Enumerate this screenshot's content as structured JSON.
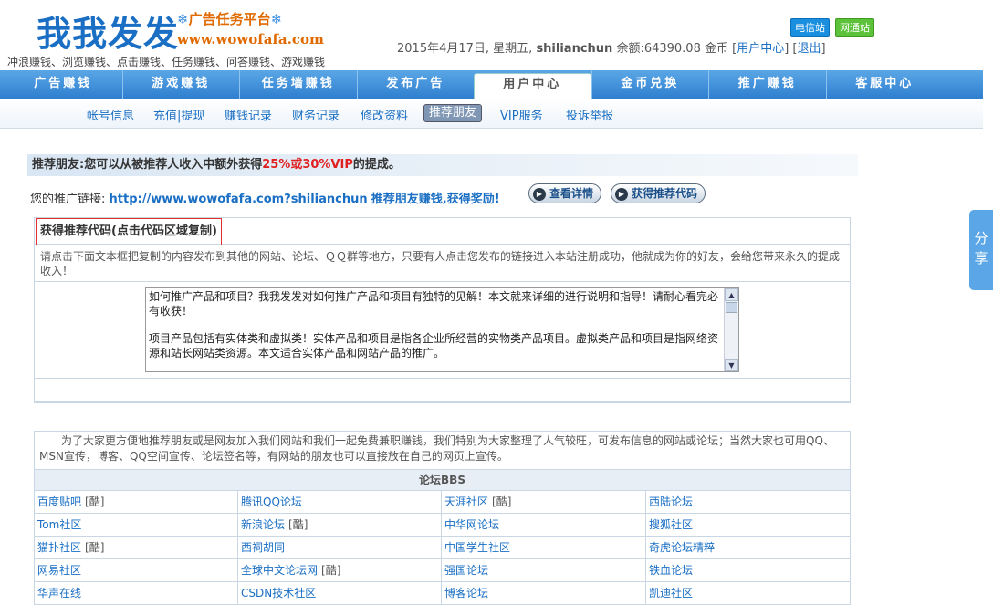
{
  "header": {
    "logo_text": "我我发发",
    "platform_name": "广告任务平台",
    "site_url": "www.wowofafa.com",
    "slogan": "冲浪赚钱、浏览赚钱、点击赚钱、任务赚钱、问答赚钱、游戏赚钱",
    "badge_telecom": "电信站",
    "badge_netcom": "网通站",
    "date": "2015年4月17日, 星期五",
    "username": "shilianchun",
    "balance_label": "余额:64390.08 金币",
    "user_center_link": "用户中心",
    "logout_link": "退出"
  },
  "nav": {
    "items": [
      "广告赚钱",
      "游戏赚钱",
      "任务墙赚钱",
      "发布广告",
      "用户中心",
      "金币兑换",
      "推广赚钱",
      "客服中心"
    ],
    "active_index": 4
  },
  "subnav": {
    "items": [
      "帐号信息",
      "充值|提现",
      "赚钱记录",
      "财务记录",
      "修改资料",
      "推荐朋友",
      "VIP服务",
      "投诉举报"
    ],
    "active_index": 5
  },
  "recommend": {
    "title_prefix": "推荐朋友:您可以从被推荐人收入中额外获得",
    "title_highlight": "25%或30%VIP",
    "title_suffix": "的提成。",
    "link_label": "您的推广链接:",
    "link_url": "http://www.wowofafa.com?shilianchun",
    "reward_text": "推荐朋友赚钱,获得奖励!",
    "btn_details": "查看详情",
    "btn_get_code": "获得推荐代码"
  },
  "code_box": {
    "heading": "获得推荐代码(点击代码区域复制)",
    "description": "请点击下面文本框把复制的内容发布到其他的网站、论坛、ＱＱ群等地方，只要有人点击您发布的链接进入本站注册成功，他就成为你的好友，会给您带来永久的提成收入！",
    "text_para1": "如何推广产品和项目？我我发发对如何推广产品和项目有独特的见解！本文就来详细的进行说明和指导！请耐心看完必有收获！",
    "text_para2": "项目产品包括有实体类和虚拟类！实体产品和项目是指各企业所经营的实物类产品项目。虚拟类产品和项目是指网络资源和站长网站类资源。本文适合实体产品和网站产品的推广。"
  },
  "forum": {
    "intro": "为了大家更方便地推荐朋友或是网友加入我们网站和我们一起免费兼职赚钱，我们特别为大家整理了人气较旺，可发布信息的网站或论坛；当然大家也可用QQ、MSN宣传，博客、QQ空间宣传、论坛签名等，有网站的朋友也可以直接放在自己的网页上宣传。",
    "header": "论坛BBS",
    "cool_tag": "[酷]",
    "cells": [
      {
        "name": "百度贴吧",
        "cool": true
      },
      {
        "name": "腾讯QQ论坛",
        "cool": false
      },
      {
        "name": "天涯社区",
        "cool": true
      },
      {
        "name": "西陆论坛",
        "cool": false
      },
      {
        "name": "Tom社区",
        "cool": false
      },
      {
        "name": "新浪论坛",
        "cool": true
      },
      {
        "name": "中华网论坛",
        "cool": false
      },
      {
        "name": "搜狐社区",
        "cool": false
      },
      {
        "name": "猫扑社区",
        "cool": true
      },
      {
        "name": "西祠胡同",
        "cool": false
      },
      {
        "name": "中国学生社区",
        "cool": false
      },
      {
        "name": "奇虎论坛精粹",
        "cool": false
      },
      {
        "name": "网易社区",
        "cool": false
      },
      {
        "name": "全球中文论坛网",
        "cool": true
      },
      {
        "name": "强国论坛",
        "cool": false
      },
      {
        "name": "铁血论坛",
        "cool": false
      },
      {
        "name": "华声在线",
        "cool": false
      },
      {
        "name": "CSDN技术社区",
        "cool": false
      },
      {
        "name": "博客论坛",
        "cool": false
      },
      {
        "name": "凯迪社区",
        "cool": false
      }
    ]
  },
  "share_tab": "分享",
  "colors": {
    "brand_blue": "#1a6fc4",
    "accent_orange": "#e06a00",
    "highlight_red": "#e02020",
    "nav_blue": "#2f7fcf"
  }
}
